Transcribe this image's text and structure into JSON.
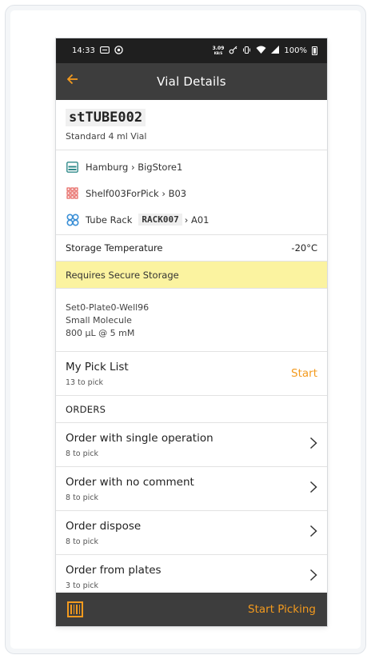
{
  "status_bar": {
    "time": "14:33",
    "speed_value": "3.09",
    "speed_unit": "KB/S",
    "battery": "100%"
  },
  "app_bar": {
    "title": "Vial Details"
  },
  "vial": {
    "id": "stTUBE002",
    "type": "Standard 4 ml Vial"
  },
  "locations": {
    "store": "Hamburg › BigStore1",
    "shelf": "Shelf003ForPick › B03",
    "rack_label": "Tube Rack",
    "rack_code": "RACK007",
    "rack_position": "› A01"
  },
  "storage": {
    "label": "Storage Temperature",
    "value": "-20°C",
    "secure_notice": "Requires Secure Storage"
  },
  "details": {
    "line1": "Set0-Plate0-Well96",
    "line2": "Small Molecule",
    "line3": "800 µL @ 5 mM"
  },
  "pick_list": {
    "name": "My Pick List",
    "count": "13 to pick",
    "action": "Start"
  },
  "orders": {
    "header": "ORDERS",
    "items": [
      {
        "name": "Order with single operation",
        "count": "8 to pick"
      },
      {
        "name": "Order with no comment",
        "count": "8 to pick"
      },
      {
        "name": "Order dispose",
        "count": "8 to pick"
      },
      {
        "name": "Order from plates",
        "count": "3 to pick"
      }
    ]
  },
  "bottom_bar": {
    "action": "Start Picking"
  },
  "colors": {
    "accent": "#f39a1e",
    "appbar": "#3d3d3d",
    "secure_bg": "#fbf3a0"
  },
  "icons": [
    "arrow-left-icon",
    "storage-box-icon",
    "shelf-grid-icon",
    "tube-rack-icon",
    "chevron-right-icon",
    "barcode-scan-icon"
  ]
}
